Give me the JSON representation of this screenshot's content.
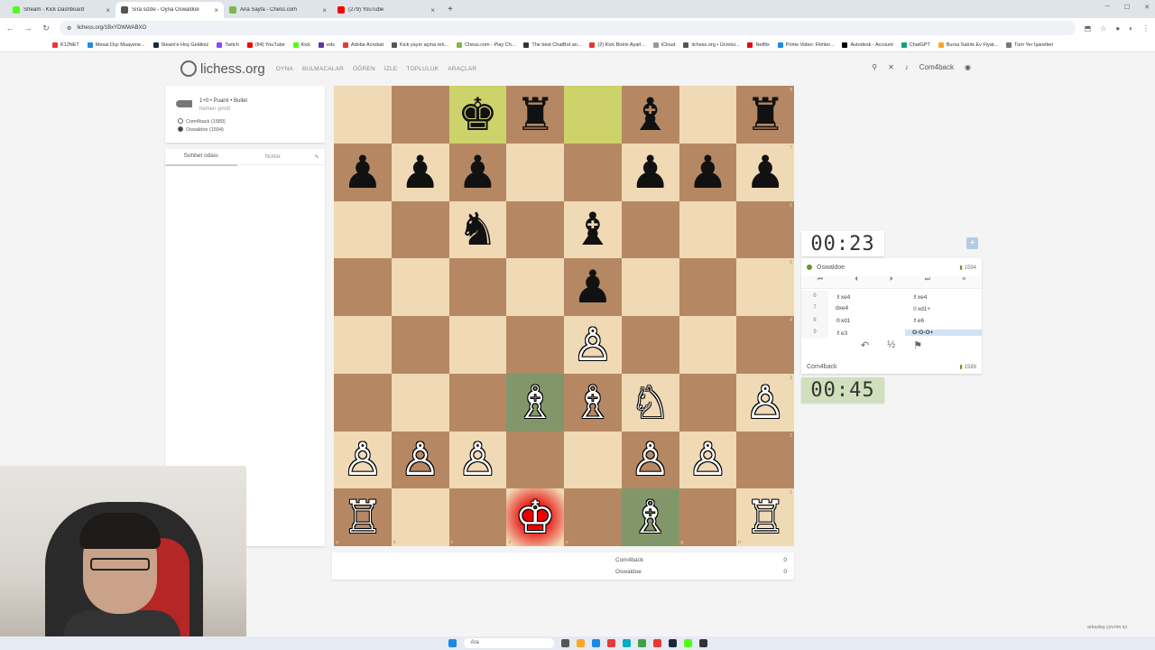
{
  "browser": {
    "tabs": [
      {
        "label": "Stream - Kick Dashboard",
        "color": "#53fc18",
        "active": false
      },
      {
        "label": "Sıra sizde - Oyna Oswaldoe",
        "color": "#555555",
        "active": true
      },
      {
        "label": "Ana Sayfa - Chess.com",
        "color": "#81b64c",
        "active": false
      },
      {
        "label": "(279) YouTube",
        "color": "#ff0000",
        "active": false
      }
    ],
    "url": "lichess.org/1BxYDWWABXO",
    "bookmarks": [
      {
        "label": "K12NET",
        "color": "#e53935"
      },
      {
        "label": "Mesai Dışı Muayene...",
        "color": "#1e88e5"
      },
      {
        "label": "Steam'e Hoş Geldiniz",
        "color": "#1b2838"
      },
      {
        "label": "Twitch",
        "color": "#9146ff"
      },
      {
        "label": "(84) YouTube",
        "color": "#ff0000"
      },
      {
        "label": "Kick",
        "color": "#53fc18"
      },
      {
        "label": "eds",
        "color": "#5e35b1"
      },
      {
        "label": "Adobe Acrobat",
        "color": "#e53935"
      },
      {
        "label": "Kick yayın açma reh...",
        "color": "#555555"
      },
      {
        "label": "Chess.com - Play Ch...",
        "color": "#81b64c"
      },
      {
        "label": "The best ChatBot an...",
        "color": "#333333"
      },
      {
        "label": "(2) Kick Botrix Ayarl...",
        "color": "#e53935"
      },
      {
        "label": "iCloud",
        "color": "#999999"
      },
      {
        "label": "lichess.org • Ücretsi...",
        "color": "#555555"
      },
      {
        "label": "Netflix",
        "color": "#e50914"
      },
      {
        "label": "Prime Video: Filmler...",
        "color": "#1e88e5"
      },
      {
        "label": "Autodesk - Account",
        "color": "#000000"
      },
      {
        "label": "ChatGPT",
        "color": "#10a37f"
      },
      {
        "label": "Bursa Satılık Ev Fiyat...",
        "color": "#f9a825"
      },
      {
        "label": "Tüm Yer İşaretleri",
        "color": "#777777"
      }
    ]
  },
  "site": {
    "logo": "lichess.org",
    "nav": [
      "OYNA",
      "BULMACALAR",
      "ÖĞREN",
      "İZLE",
      "TOPLULUK",
      "ARAÇLAR"
    ],
    "username": "Com4back"
  },
  "game": {
    "type": "1+0 • Puanlı • Bullet",
    "time_ago": "hemen şimdi",
    "white_player": "Com4back (1589)",
    "black_player": "Oswaldoe (1594)"
  },
  "chat": {
    "tab_chat": "Sohbet odası",
    "tab_notes": "Notlar"
  },
  "board": {
    "ranks": [
      [
        "",
        "",
        "♚",
        "♜",
        "",
        "♝",
        "",
        "♜"
      ],
      [
        "♟",
        "♟",
        "♟",
        "",
        "",
        "♟",
        "♟",
        "♟"
      ],
      [
        "",
        "",
        "♞",
        "",
        "♝",
        "",
        "",
        ""
      ],
      [
        "",
        "",
        "",
        "",
        "♟",
        "",
        "",
        ""
      ],
      [
        "",
        "",
        "",
        "",
        "♙",
        "",
        "",
        ""
      ],
      [
        "",
        "",
        "",
        "♗",
        "♗",
        "♘",
        "",
        "♙"
      ],
      [
        "♙",
        "♙",
        "♙",
        "",
        "",
        "♙",
        "♙",
        ""
      ],
      [
        "♖",
        "",
        "",
        "♔",
        "",
        "♗",
        "",
        "♖"
      ]
    ],
    "files": [
      "a",
      "b",
      "c",
      "d",
      "e",
      "f",
      "g",
      "h"
    ],
    "rank_labels": [
      "8",
      "7",
      "6",
      "5",
      "4",
      "3",
      "2",
      "1"
    ]
  },
  "clocks": {
    "opponent": "00:23",
    "player": "00:45"
  },
  "opponent": {
    "name": "Oswaldoe",
    "rating": "1594"
  },
  "player": {
    "name": "Com4back",
    "rating": "1589"
  },
  "moves": [
    {
      "num": "6",
      "white": "♗xe4",
      "black": "♗xe4"
    },
    {
      "num": "7",
      "white": "dxe4",
      "black": "♕xd1+"
    },
    {
      "num": "8",
      "white": "♔xd1",
      "black": "♗e6"
    },
    {
      "num": "9",
      "white": "♗e3",
      "black": "O-O-O+"
    }
  ],
  "controls": {
    "first": "⏮",
    "prev": "⏴",
    "next": "⏵",
    "last": "⏭",
    "menu": "≡",
    "takeback": "↶",
    "draw": "½",
    "resign": "⚑"
  },
  "scores": [
    {
      "name": "Com4back",
      "value": "0"
    },
    {
      "name": "Oswaldoe",
      "value": "0"
    }
  ],
  "taskbar": {
    "search": "Ara",
    "friends": "arkadaş çevrim içi"
  },
  "colors": {
    "light_square": "#f0d9b5",
    "dark_square": "#b58863",
    "last_move": "#cdd26a",
    "check": "#ff0000",
    "active_clock": "#d0e0bd"
  }
}
